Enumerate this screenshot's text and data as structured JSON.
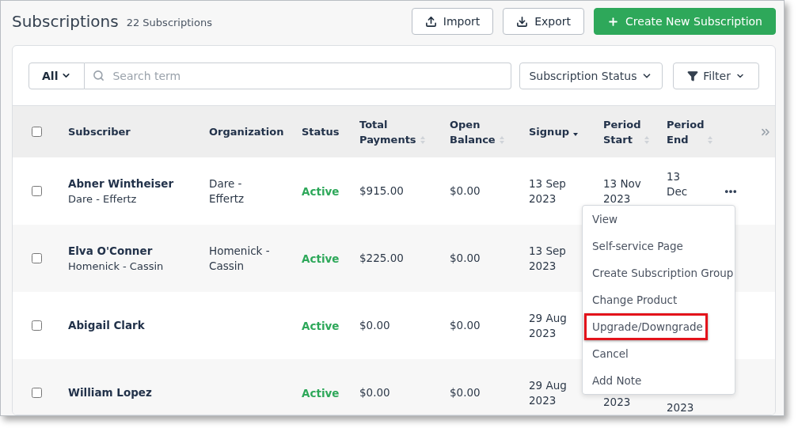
{
  "header": {
    "title": "Subscriptions",
    "count": "22 Subscriptions",
    "buttons": [
      {
        "label": "Import",
        "kind": "import"
      },
      {
        "label": "Export",
        "kind": "export"
      },
      {
        "label": "Create New Subscription",
        "kind": "create"
      }
    ]
  },
  "filters": {
    "scope": "All",
    "search": {
      "placeholder": "Search term"
    },
    "status_dropdown": "Subscription Status",
    "filter_button": "Filter"
  },
  "table": {
    "select_all": {
      "checked": false
    },
    "columns": [
      {
        "label": "Subscriber",
        "sortable": false,
        "sorted": false
      },
      {
        "label": "Organization",
        "sortable": false,
        "sorted": false
      },
      {
        "label": "Status",
        "sortable": false,
        "sorted": false
      },
      {
        "label": "Total Payments",
        "sortable": true,
        "sorted": false
      },
      {
        "label": "Open Balance",
        "sortable": true,
        "sorted": false
      },
      {
        "label": "Signup",
        "sortable": true,
        "sorted": true
      },
      {
        "label": "Period Start",
        "sortable": true,
        "sorted": false
      },
      {
        "label": "Period End",
        "sortable": true,
        "sorted": false
      }
    ],
    "rows": [
      {
        "checked": false,
        "name": "Abner Wintheiser",
        "company": "Dare - Effertz",
        "organization": "Dare - Effertz",
        "status": "Active",
        "total_payments": "$915.00",
        "open_balance": "$0.00",
        "signup": "13 Sep 2023",
        "period_start": "13 Nov 2023",
        "period_end": "13 Dec",
        "actions": true
      },
      {
        "checked": false,
        "name": "Elva O'Conner",
        "company": "Homenick - Cassin",
        "organization": "Homenick - Cassin",
        "status": "Active",
        "total_payments": "$225.00",
        "open_balance": "$0.00",
        "signup": "13 Sep 2023"
      },
      {
        "checked": false,
        "name": "Abigail Clark",
        "status": "Active",
        "total_payments": "$0.00",
        "open_balance": "$0.00",
        "signup": "29 Aug 2023"
      },
      {
        "checked": false,
        "name": "William Lopez",
        "status": "Active",
        "total_payments": "$0.00",
        "open_balance": "$0.00",
        "signup": "29 Aug 2023",
        "period_start": "2023",
        "period_end": "2023",
        "covered": true
      }
    ]
  },
  "menu": {
    "items": [
      {
        "label": "View",
        "highlighted": false
      },
      {
        "label": "Self-service Page",
        "highlighted": false
      },
      {
        "label": "Create Subscription Group",
        "highlighted": false
      },
      {
        "label": "Change Product",
        "highlighted": false
      },
      {
        "label": "Upgrade/Downgrade",
        "highlighted": true
      },
      {
        "label": "Cancel",
        "highlighted": false
      },
      {
        "label": "Add Note",
        "highlighted": false
      }
    ]
  }
}
